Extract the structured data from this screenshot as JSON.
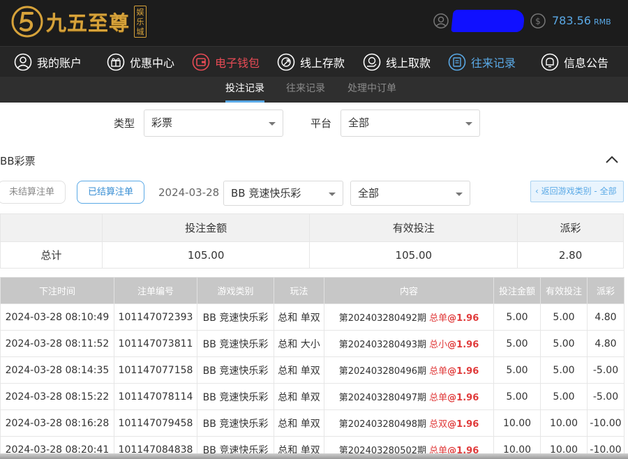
{
  "header": {
    "logo_text": "九五至尊",
    "logo_badge": "娱乐城",
    "balance_amount": "783.56",
    "balance_unit": "RMB"
  },
  "nav": {
    "items": [
      {
        "label": "我的账户",
        "icon": "user-circle-icon"
      },
      {
        "label": "优惠中心",
        "icon": "gift-icon"
      },
      {
        "label": "电子钱包",
        "icon": "wallet-icon"
      },
      {
        "label": "线上存款",
        "icon": "deposit-icon"
      },
      {
        "label": "线上取款",
        "icon": "withdraw-icon"
      },
      {
        "label": "往来记录",
        "icon": "records-icon"
      },
      {
        "label": "信息公告",
        "icon": "bell-icon"
      }
    ]
  },
  "subnav": {
    "tabs": [
      "投注记录",
      "往来记录",
      "处理中订单"
    ],
    "active": "投注记录"
  },
  "filters": {
    "type_label": "类型",
    "type_value": "彩票",
    "platform_label": "平台",
    "platform_value": "全部"
  },
  "section": {
    "title": "BB彩票",
    "unsettled_label": "未结算注单",
    "settled_label": "已结算注单",
    "date": "2024-03-28",
    "game_select": "BB 竞速快乐彩",
    "play_select": "全部",
    "back_label": "‹ 返回游戏类别 - 全部"
  },
  "summary": {
    "headers": [
      "",
      "投注金额",
      "有效投注",
      "派彩"
    ],
    "total_label": "总计",
    "bet_amount": "105.00",
    "valid_bet": "105.00",
    "payout": "2.80"
  },
  "records": {
    "headers": [
      "下注时间",
      "注单编号",
      "游戏类别",
      "玩法",
      "内容",
      "投注金额",
      "有效投注",
      "派彩"
    ],
    "rows": [
      {
        "time": "2024-03-28 08:10:49",
        "id": "101147072393",
        "game": "BB 竞速快乐彩",
        "play": "总和 单双",
        "period": "第202403280492期",
        "pick": "总单",
        "odds": "@1.96",
        "bet": "5.00",
        "valid": "5.00",
        "payout": "4.80"
      },
      {
        "time": "2024-03-28 08:11:52",
        "id": "101147073811",
        "game": "BB 竞速快乐彩",
        "play": "总和 大小",
        "period": "第202403280493期",
        "pick": "总小",
        "odds": "@1.96",
        "bet": "5.00",
        "valid": "5.00",
        "payout": "4.80"
      },
      {
        "time": "2024-03-28 08:14:35",
        "id": "101147077158",
        "game": "BB 竞速快乐彩",
        "play": "总和 单双",
        "period": "第202403280496期",
        "pick": "总单",
        "odds": "@1.96",
        "bet": "5.00",
        "valid": "5.00",
        "payout": "-5.00"
      },
      {
        "time": "2024-03-28 08:15:22",
        "id": "101147078114",
        "game": "BB 竞速快乐彩",
        "play": "总和 单双",
        "period": "第202403280497期",
        "pick": "总单",
        "odds": "@1.96",
        "bet": "5.00",
        "valid": "5.00",
        "payout": "-5.00"
      },
      {
        "time": "2024-03-28 08:16:28",
        "id": "101147079458",
        "game": "BB 竞速快乐彩",
        "play": "总和 单双",
        "period": "第202403280498期",
        "pick": "总双",
        "odds": "@1.96",
        "bet": "10.00",
        "valid": "10.00",
        "payout": "-10.00"
      },
      {
        "time": "2024-03-28 08:20:41",
        "id": "101147084838",
        "game": "BB 竞速快乐彩",
        "play": "总和 单双",
        "period": "第202403280502期",
        "pick": "总单",
        "odds": "@1.96",
        "bet": "10.00",
        "valid": "10.00",
        "payout": "-10.00"
      }
    ]
  },
  "colors": {
    "accent_blue": "#5aa9e6",
    "accent_red": "#e03b3b",
    "logo_gold": "#d6a23a"
  }
}
